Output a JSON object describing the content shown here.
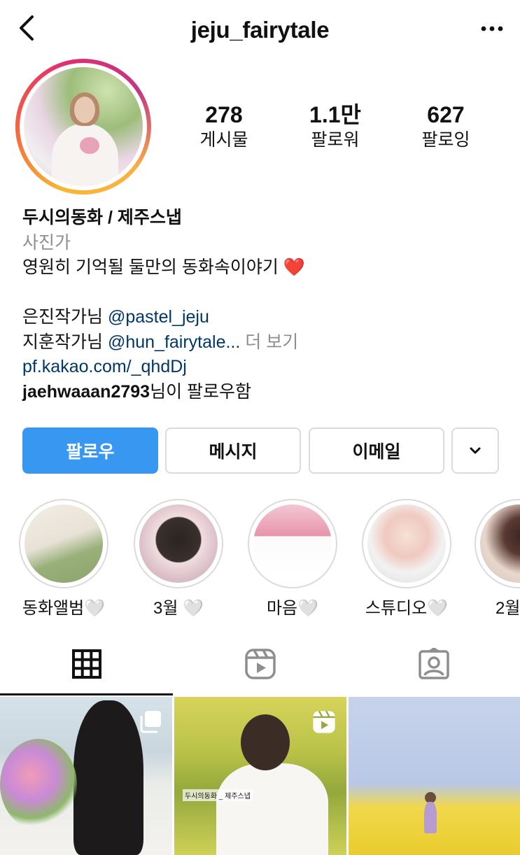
{
  "header": {
    "username": "jeju_fairytale"
  },
  "stats": [
    {
      "value": "278",
      "label": "게시물"
    },
    {
      "value": "1.1만",
      "label": "팔로워"
    },
    {
      "value": "627",
      "label": "팔로잉"
    }
  ],
  "bio": {
    "name": "두시의동화 / 제주스냅",
    "category": "사진가",
    "line1": "영원히 기억될 둘만의 동화속이야기 ",
    "line1_emoji": "❤️",
    "line2_prefix": "은진작가님 ",
    "line2_mention": "@pastel_jeju",
    "line3_prefix": "지훈작가님 ",
    "line3_mention": "@hun_fairytale...",
    "line3_more": " 더 보기",
    "link": "pf.kakao.com/_qhdDj",
    "followed_by_user": "jaehwaaan2793",
    "followed_by_suffix": "님이 팔로우함"
  },
  "buttons": {
    "follow": "팔로우",
    "message": "메시지",
    "email": "이메일"
  },
  "highlights": [
    {
      "label": "동화앨범🤍"
    },
    {
      "label": "3월 🤍"
    },
    {
      "label": "마음🤍"
    },
    {
      "label": "스튜디오🤍"
    },
    {
      "label": "2월"
    }
  ],
  "grid": {
    "post2_caption": "두시의동화 _ 제주스냅"
  },
  "colors": {
    "follow_button": "#3897f0",
    "link": "#00376b",
    "secondary_text": "#8e8e8e",
    "heart": "#e0245e"
  }
}
